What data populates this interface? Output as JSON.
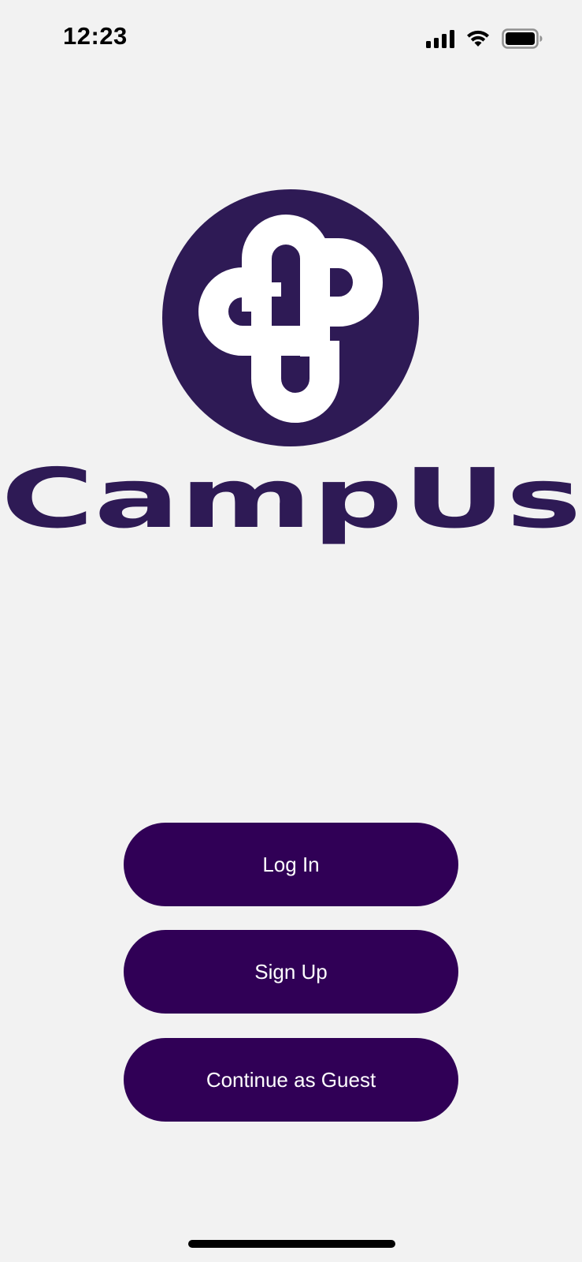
{
  "status_bar": {
    "time": "12:23",
    "icons": [
      "signal-icon",
      "wifi-icon",
      "battery-icon"
    ]
  },
  "logo": {
    "wordmark": "CampUs",
    "colors": {
      "circle": "#2e1a55",
      "glyph": "#ffffff"
    }
  },
  "actions": {
    "login_label": "Log In",
    "signup_label": "Sign Up",
    "guest_label": "Continue as Guest"
  },
  "colors": {
    "background": "#f2f2f2",
    "button": "#300056",
    "button_text": "#ffffff"
  }
}
